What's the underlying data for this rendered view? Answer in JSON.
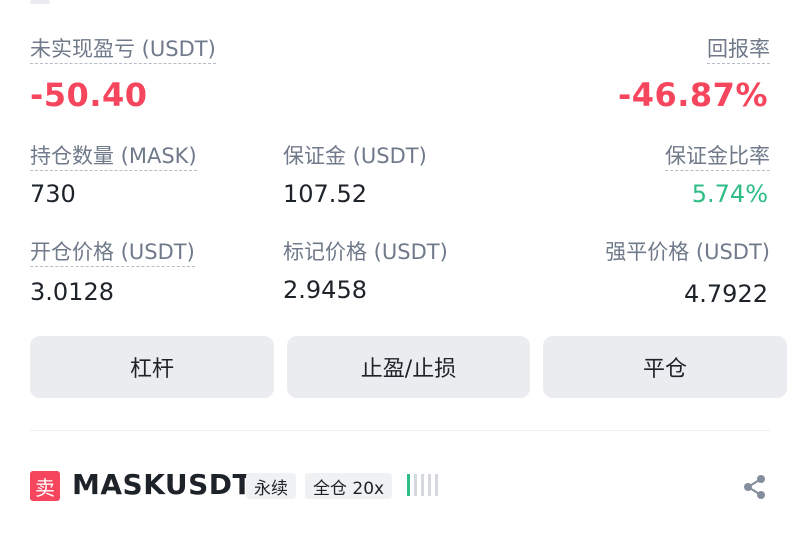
{
  "position": {
    "unrealized_pnl_label": "未实现盈亏 (USDT)",
    "unrealized_pnl_value": "-50.40",
    "roe_label": "回报率",
    "roe_value": "-46.87%",
    "size_label": "持仓数量 (MASK)",
    "size_value": "730",
    "margin_label": "保证金 (USDT)",
    "margin_value": "107.52",
    "margin_ratio_label": "保证金比率",
    "margin_ratio_value": "5.74%",
    "entry_price_label": "开仓价格 (USDT)",
    "entry_price_value": "3.0128",
    "mark_price_label": "标记价格 (USDT)",
    "mark_price_value": "2.9458",
    "liq_price_label": "强平价格 (USDT)",
    "liq_price_value": "4.7922"
  },
  "actions": {
    "leverage_label": "杠杆",
    "tpsl_label": "止盈/止损",
    "close_label": "平仓"
  },
  "next_position": {
    "side_badge": "卖",
    "symbol": "MASKUSDT",
    "type_tag": "永续",
    "margin_tag": "全仓 20x",
    "share_icon": "share-icon"
  },
  "colors": {
    "negative": "#f6465d",
    "positive": "#2ebd85",
    "button_bg": "#eaecef"
  }
}
